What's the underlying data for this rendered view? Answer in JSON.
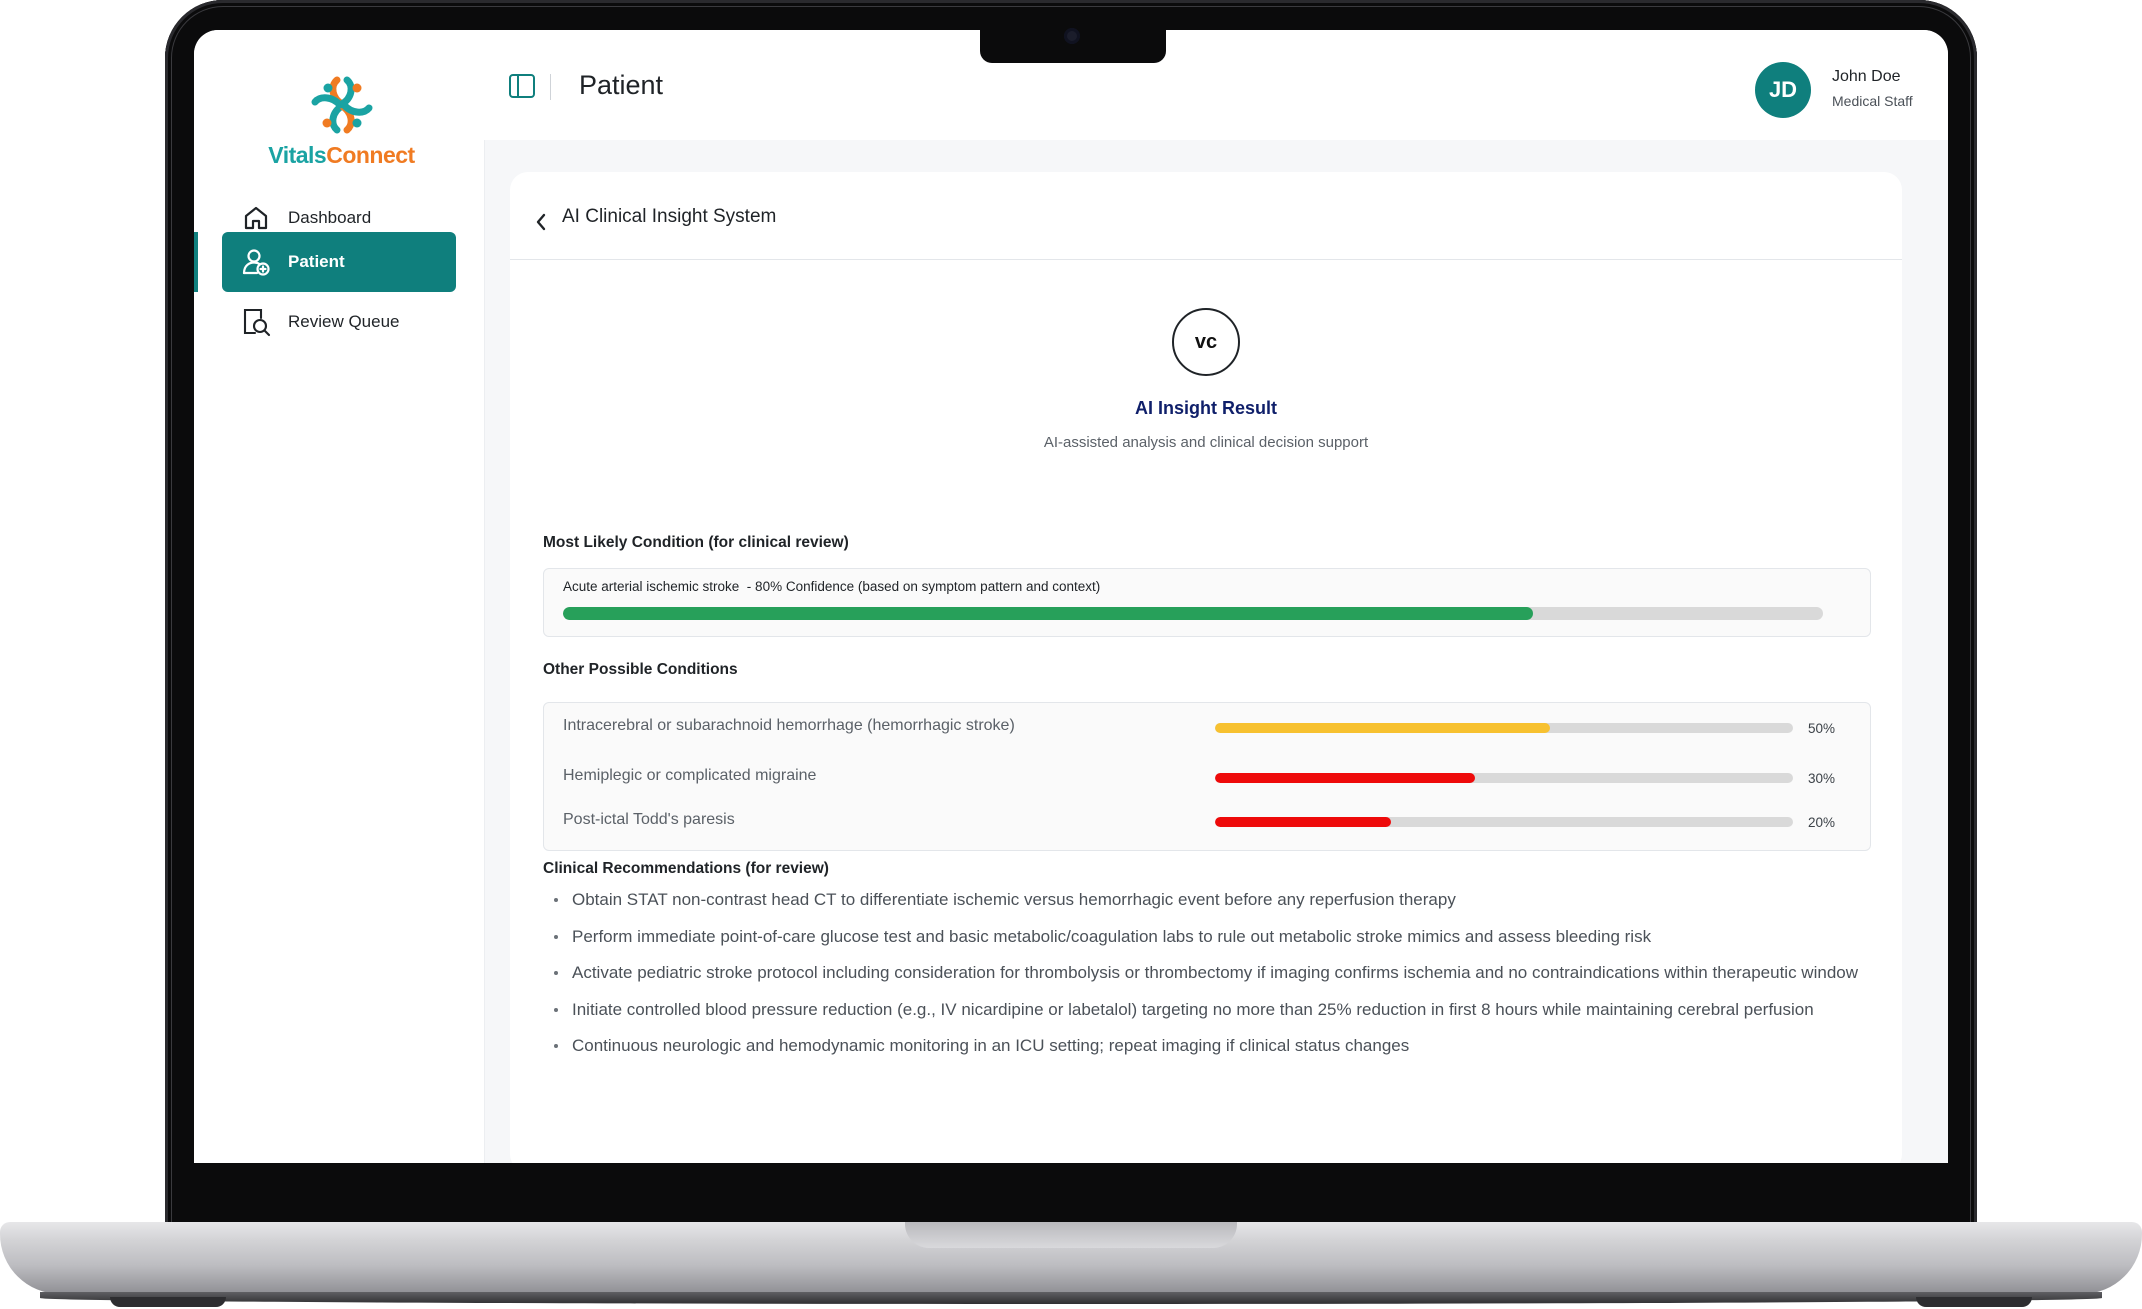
{
  "app": {
    "logo": {
      "text_part1": "Vitals",
      "text_part2": "Connect",
      "icon": "vitalsconnect-logo-icon"
    },
    "colors": {
      "brand": "#0f7f7d",
      "logo_teal": "#1aa3a3",
      "logo_orange": "#f07b22",
      "title_navy": "#0f1f6a"
    }
  },
  "sidebar": {
    "items": [
      {
        "label": "Dashboard",
        "icon": "home-icon",
        "active": false
      },
      {
        "label": "Patient",
        "icon": "patient-icon",
        "active": true
      },
      {
        "label": "Review Queue",
        "icon": "review-search-icon",
        "active": false
      }
    ]
  },
  "header": {
    "title": "Patient",
    "toggle_icon": "sidebar-toggle-icon",
    "user": {
      "initials": "JD",
      "name": "John Doe",
      "role": "Medical Staff"
    }
  },
  "card": {
    "title": "AI Clinical Insight System",
    "back_icon": "chevron-left-icon",
    "badge": "vc",
    "result_title": "AI Insight Result",
    "result_subtitle": "AI-assisted analysis and clinical decision support",
    "primary": {
      "section_label": "Most Likely Condition (for clinical review)",
      "text": "Acute arterial ischemic stroke  - 80% Confidence (based on symptom pattern and context)",
      "confidence": 0.77,
      "color": "#27a05a"
    },
    "others": {
      "section_label": "Other Possible Conditions",
      "items": [
        {
          "name": "Intracerebral or subarachnoid hemorrhage (hemorrhagic stroke)",
          "pct_label": "50%",
          "fraction": 0.58,
          "color": "#f7c130"
        },
        {
          "name": "Hemiplegic or complicated migraine",
          "pct_label": "30%",
          "fraction": 0.45,
          "color": "#ee0a0a"
        },
        {
          "name": "Post-ictal Todd's paresis",
          "pct_label": "20%",
          "fraction": 0.305,
          "color": "#ee0a0a"
        }
      ]
    },
    "recommendations": {
      "section_label": "Clinical Recommendations (for review)",
      "items": [
        "Obtain STAT non-contrast head CT to differentiate ischemic versus hemorrhagic event before any reperfusion therapy",
        "Perform immediate point-of-care glucose test and basic metabolic/coagulation labs to rule out metabolic stroke mimics and assess bleeding risk",
        "Activate pediatric stroke protocol including consideration for thrombolysis or thrombectomy if imaging confirms ischemia and no contraindications within therapeutic window",
        "Initiate controlled blood pressure reduction (e.g., IV nicardipine or labetalol) targeting no more than 25% reduction in first 8 hours while maintaining cerebral perfusion",
        "Continuous neurologic and hemodynamic monitoring in an ICU setting; repeat imaging if clinical status changes"
      ]
    }
  }
}
